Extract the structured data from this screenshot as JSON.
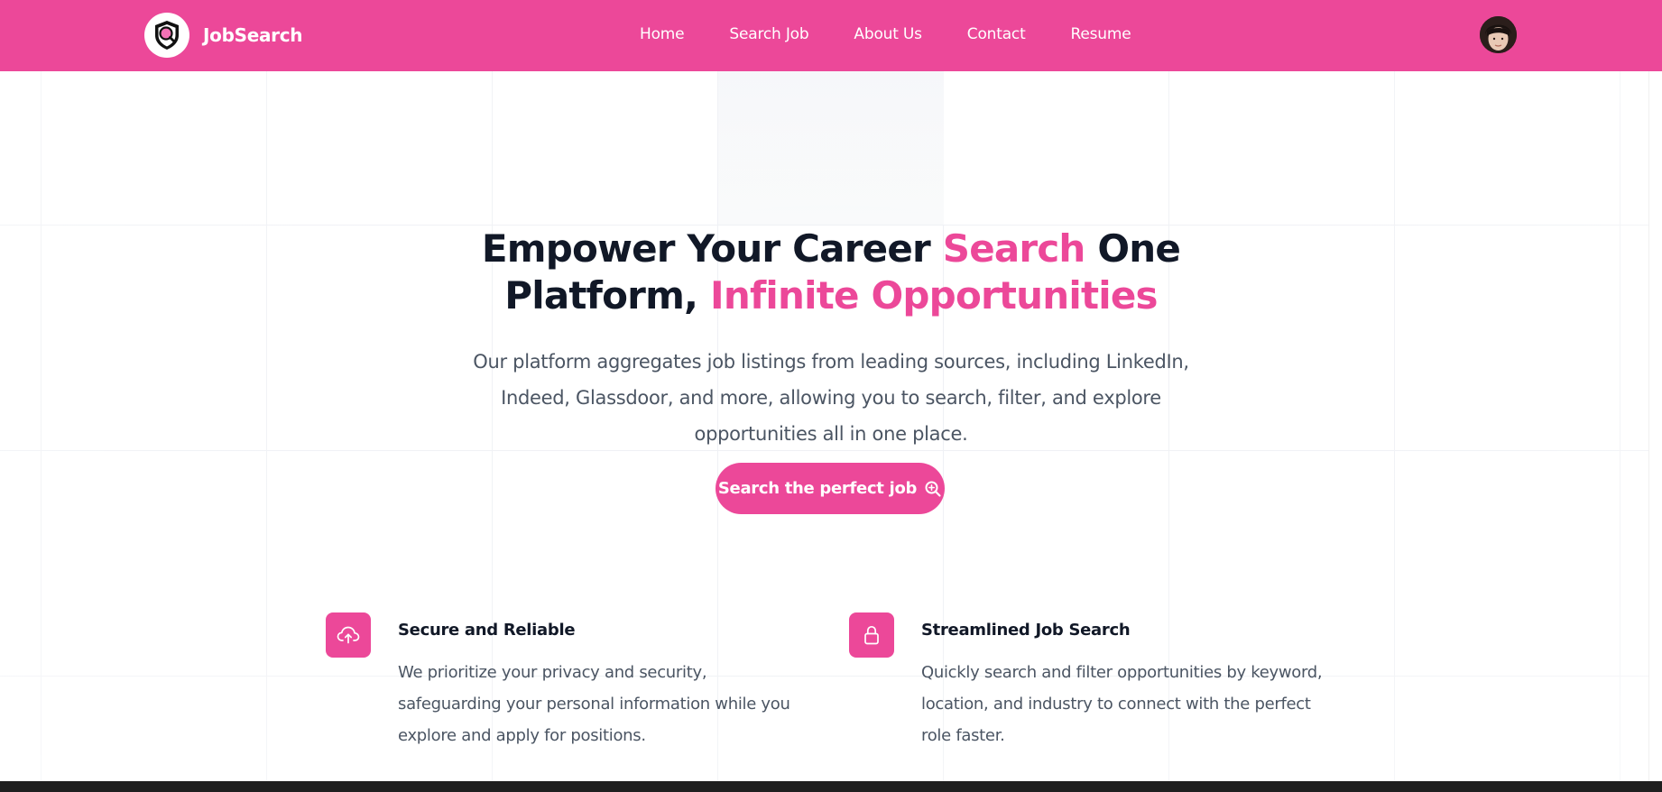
{
  "brand": {
    "name": "JobSearch",
    "logo_icon": "shield-search-icon"
  },
  "nav": {
    "items": [
      {
        "label": "Home"
      },
      {
        "label": "Search Job"
      },
      {
        "label": "About Us"
      },
      {
        "label": "Contact"
      },
      {
        "label": "Resume"
      }
    ]
  },
  "user": {
    "avatar_icon": "user-avatar"
  },
  "hero": {
    "title_part1": "Empower Your Career ",
    "title_accent1": "Search",
    "title_part2": " One Platform, ",
    "title_accent2": "Infinite Opportunities",
    "description": "Our platform aggregates job listings from leading sources, including LinkedIn, Indeed, Glassdoor, and more, allowing you to search, filter, and explore opportunities all in one place.",
    "cta_label": "Search the perfect job",
    "cta_icon": "search-zoom-icon"
  },
  "features": [
    {
      "icon": "cloud-upload-icon",
      "title": "Secure and Reliable",
      "text": "We prioritize your privacy and security, safeguarding your personal information while you explore and apply for positions."
    },
    {
      "icon": "lock-icon",
      "title": "Streamlined Job Search",
      "text": "Quickly search and filter opportunities by keyword, location, and industry to connect with the perfect role faster."
    }
  ],
  "colors": {
    "accent": "#ec4899",
    "heading": "#111827",
    "body_text": "#4b5563"
  }
}
